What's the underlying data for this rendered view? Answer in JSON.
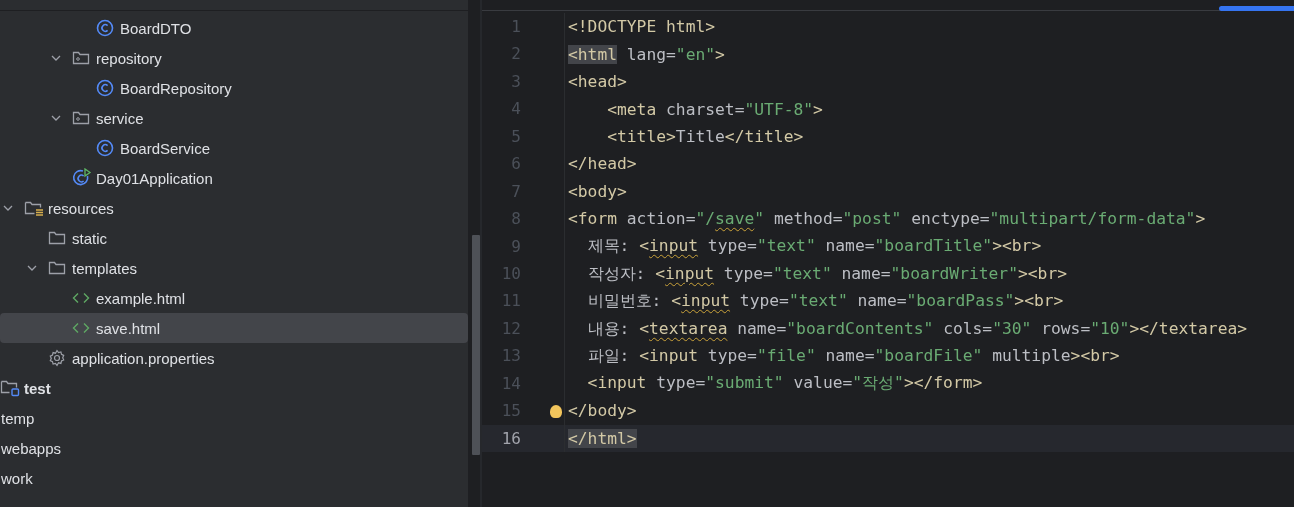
{
  "project_tree": [
    {
      "children": [
        {
          "children": [
            {
              "children": [
                {
                  "children": [
                    {
                      "label": "BoardDTO",
                      "kind": "class",
                      "selected": false
                    }
                  ]
                },
                {
                  "label": "repository",
                  "kind": "package",
                  "expanded": true,
                  "selected": false,
                  "children": [
                    {
                      "label": "BoardRepository",
                      "kind": "class",
                      "selected": false
                    }
                  ]
                },
                {
                  "label": "service",
                  "kind": "package",
                  "expanded": true,
                  "selected": false,
                  "children": [
                    {
                      "label": "BoardService",
                      "kind": "class",
                      "selected": false
                    }
                  ]
                },
                {
                  "label": "Day01Application",
                  "kind": "app",
                  "selected": false
                }
              ]
            }
          ]
        },
        {
          "label": "resources",
          "kind": "resources",
          "expanded": true,
          "selected": false,
          "children": [
            {
              "label": "static",
              "kind": "folder",
              "selected": false
            },
            {
              "label": "templates",
              "kind": "folder",
              "expanded": true,
              "selected": false,
              "children": [
                {
                  "label": "example.html",
                  "kind": "html",
                  "selected": false
                },
                {
                  "label": "save.html",
                  "kind": "html",
                  "selected": true
                }
              ]
            },
            {
              "label": "application.properties",
              "kind": "properties",
              "selected": false
            }
          ]
        }
      ]
    },
    {
      "label": "test",
      "kind": "test",
      "selected": false
    },
    {
      "label": "temp",
      "kind": "plain",
      "selected": false
    },
    {
      "label": "webapps",
      "kind": "plain",
      "selected": false
    },
    {
      "label": "work",
      "kind": "plain",
      "selected": false
    }
  ],
  "editor": {
    "lines": [
      {
        "number": "1",
        "current": false,
        "tokens": [
          {
            "kind": "tag",
            "text": "<!DOCTYPE html>"
          }
        ]
      },
      {
        "number": "2",
        "current": false,
        "tokens": [
          {
            "kind": "tag",
            "text": "<html",
            "matched": true
          },
          {
            "kind": "attr",
            "text": " lang="
          },
          {
            "kind": "value",
            "text": "\"en\""
          },
          {
            "kind": "tag",
            "text": ">"
          }
        ]
      },
      {
        "number": "3",
        "current": false,
        "tokens": [
          {
            "kind": "tag",
            "text": "<head>"
          }
        ]
      },
      {
        "number": "4",
        "current": false,
        "tokens": [
          {
            "kind": "tag",
            "text": "    <meta"
          },
          {
            "kind": "attr",
            "text": " charset="
          },
          {
            "kind": "value",
            "text": "\"UTF-8\""
          },
          {
            "kind": "tag",
            "text": ">"
          }
        ]
      },
      {
        "number": "5",
        "current": false,
        "tokens": [
          {
            "kind": "tag",
            "text": "    <title>"
          },
          {
            "kind": "text",
            "text": "Title"
          },
          {
            "kind": "tag",
            "text": "</title>"
          }
        ]
      },
      {
        "number": "6",
        "current": false,
        "tokens": [
          {
            "kind": "tag",
            "text": "</head>"
          }
        ]
      },
      {
        "number": "7",
        "current": false,
        "tokens": [
          {
            "kind": "tag",
            "text": "<body>"
          }
        ]
      },
      {
        "number": "8",
        "current": false,
        "tokens": [
          {
            "kind": "tag",
            "text": "<form"
          },
          {
            "kind": "attr",
            "text": " action="
          },
          {
            "kind": "value",
            "text": "\"/"
          },
          {
            "kind": "value",
            "text": "save",
            "warning": true
          },
          {
            "kind": "value",
            "text": "\""
          },
          {
            "kind": "attr",
            "text": " method="
          },
          {
            "kind": "value",
            "text": "\"post\""
          },
          {
            "kind": "attr",
            "text": " enctype="
          },
          {
            "kind": "value",
            "text": "\"multipart/form-data\""
          },
          {
            "kind": "tag",
            "text": ">"
          }
        ]
      },
      {
        "number": "9",
        "current": false,
        "tokens": [
          {
            "kind": "text",
            "text": "  제목: "
          },
          {
            "kind": "tag",
            "text": "<"
          },
          {
            "kind": "tag",
            "text": "input",
            "warning": true
          },
          {
            "kind": "attr",
            "text": " type="
          },
          {
            "kind": "value",
            "text": "\"text\""
          },
          {
            "kind": "attr",
            "text": " name="
          },
          {
            "kind": "value",
            "text": "\"boardTitle\""
          },
          {
            "kind": "tag",
            "text": "><br>"
          }
        ]
      },
      {
        "number": "10",
        "current": false,
        "tokens": [
          {
            "kind": "text",
            "text": "  작성자: "
          },
          {
            "kind": "tag",
            "text": "<"
          },
          {
            "kind": "tag",
            "text": "input",
            "warning": true
          },
          {
            "kind": "attr",
            "text": " type="
          },
          {
            "kind": "value",
            "text": "\"text\""
          },
          {
            "kind": "attr",
            "text": " name="
          },
          {
            "kind": "value",
            "text": "\"boardWriter\""
          },
          {
            "kind": "tag",
            "text": "><br>"
          }
        ]
      },
      {
        "number": "11",
        "current": false,
        "tokens": [
          {
            "kind": "text",
            "text": "  비밀번호: "
          },
          {
            "kind": "tag",
            "text": "<"
          },
          {
            "kind": "tag",
            "text": "input",
            "warning": true
          },
          {
            "kind": "attr",
            "text": " type="
          },
          {
            "kind": "value",
            "text": "\"text\""
          },
          {
            "kind": "attr",
            "text": " name="
          },
          {
            "kind": "value",
            "text": "\"boardPass\""
          },
          {
            "kind": "tag",
            "text": "><br>"
          }
        ]
      },
      {
        "number": "12",
        "current": false,
        "tokens": [
          {
            "kind": "text",
            "text": "  내용: "
          },
          {
            "kind": "tag",
            "text": "<"
          },
          {
            "kind": "tag",
            "text": "textarea",
            "warning": true
          },
          {
            "kind": "attr",
            "text": " name="
          },
          {
            "kind": "value",
            "text": "\"boardContents\""
          },
          {
            "kind": "attr",
            "text": " cols="
          },
          {
            "kind": "value",
            "text": "\"30\""
          },
          {
            "kind": "attr",
            "text": " rows="
          },
          {
            "kind": "value",
            "text": "\"10\""
          },
          {
            "kind": "tag",
            "text": "></textarea>"
          }
        ]
      },
      {
        "number": "13",
        "current": false,
        "tokens": [
          {
            "kind": "text",
            "text": "  파일: "
          },
          {
            "kind": "tag",
            "text": "<input"
          },
          {
            "kind": "attr",
            "text": " type="
          },
          {
            "kind": "value",
            "text": "\"file\""
          },
          {
            "kind": "attr",
            "text": " name="
          },
          {
            "kind": "value",
            "text": "\"boardFile\""
          },
          {
            "kind": "attr",
            "text": " multiple"
          },
          {
            "kind": "tag",
            "text": "><br>"
          }
        ]
      },
      {
        "number": "14",
        "current": false,
        "tokens": [
          {
            "kind": "tag",
            "text": "  <input"
          },
          {
            "kind": "attr",
            "text": " type="
          },
          {
            "kind": "value",
            "text": "\"submit\""
          },
          {
            "kind": "attr",
            "text": " value="
          },
          {
            "kind": "value",
            "text": "\"작성\""
          },
          {
            "kind": "tag",
            "text": "></form>"
          }
        ]
      },
      {
        "number": "15",
        "current": false,
        "tokens": [
          {
            "kind": "tag",
            "text": "</body>"
          }
        ]
      },
      {
        "number": "16",
        "current": true,
        "tokens": [
          {
            "kind": "tag",
            "text": "</html>",
            "matched": true
          }
        ]
      }
    ]
  }
}
